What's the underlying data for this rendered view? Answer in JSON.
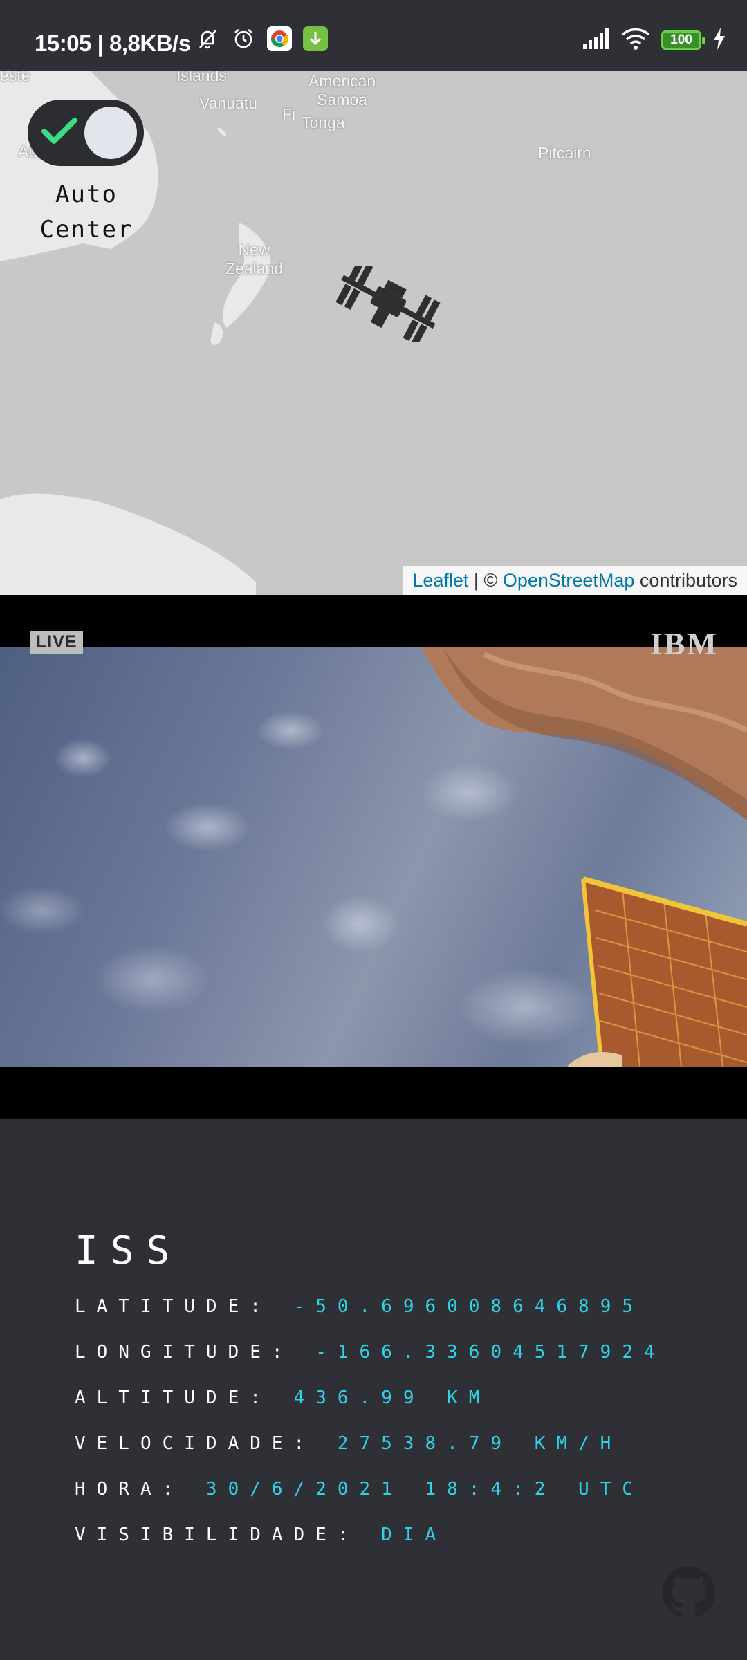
{
  "status_bar": {
    "time": "15:05",
    "speed": "8,8KB/s",
    "battery": "100",
    "icons": [
      "bell-off-icon",
      "alarm-icon",
      "chrome-icon",
      "download-icon",
      "signal-icon",
      "wifi-icon",
      "battery-icon",
      "charging-icon"
    ]
  },
  "map": {
    "toggle": {
      "state": "on",
      "label_line1": "Auto",
      "label_line2": "Center"
    },
    "places": {
      "islands": "Islands",
      "vanuatu": "Vanuatu",
      "fiji": "Fi",
      "american_samoa_1": "American",
      "american_samoa_2": "Samoa",
      "tonga": "Tonga",
      "pitcairn": "Pitcairn",
      "australia": "Australia",
      "new_zealand_1": "New",
      "new_zealand_2": "Zealand",
      "cut_top": "este"
    },
    "attribution": {
      "leaflet": "Leaflet",
      "separator": " | © ",
      "osm": "OpenStreetMap",
      "contributors": " contributors"
    }
  },
  "video": {
    "live_badge": "LIVE",
    "brand": "IBM"
  },
  "iss_info": {
    "title": "ISS",
    "rows": [
      {
        "label": "LATITUDE: ",
        "value": "-50.696008646895"
      },
      {
        "label": "LONGITUDE: ",
        "value": "-166.33604517924"
      },
      {
        "label": "ALTITUDE: ",
        "value": "436.99 KM"
      },
      {
        "label": "VELOCIDADE: ",
        "value": "27538.79 KM/H"
      },
      {
        "label": "HORA: ",
        "value": "30/6/2021 18:4:2 UTC"
      },
      {
        "label": "VISIBILIDADE: ",
        "value": "DIA"
      }
    ]
  },
  "colors": {
    "background": "#2e3035",
    "value_accent": "#2fd3e6",
    "toggle_check": "#3ddc84",
    "link": "#0078a8"
  }
}
